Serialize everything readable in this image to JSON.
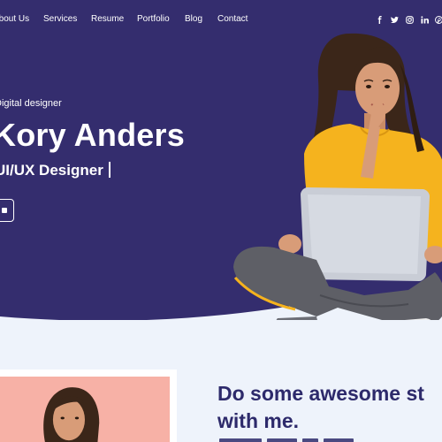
{
  "nav": {
    "items": [
      "About Us",
      "Services",
      "Resume",
      "Portfolio",
      "Blog",
      "Contact"
    ],
    "social_icons": [
      "facebook-icon",
      "twitter-icon",
      "instagram-icon",
      "linkedin-icon",
      "pinterest-icon"
    ]
  },
  "hero": {
    "subtitle": "Digital designer",
    "name": "Kory Anders",
    "typed_text": "UI/UX Designer",
    "button_icon": "play-icon"
  },
  "about": {
    "heading_line1": "Do some awesome st",
    "heading_line2": "with me."
  },
  "colors": {
    "hero_bg": "#342d6e",
    "page_bg": "#eef3fb",
    "heading": "#2d2a6b",
    "shirt": "#f5b31e",
    "photo_bg": "#f7b1a6"
  }
}
